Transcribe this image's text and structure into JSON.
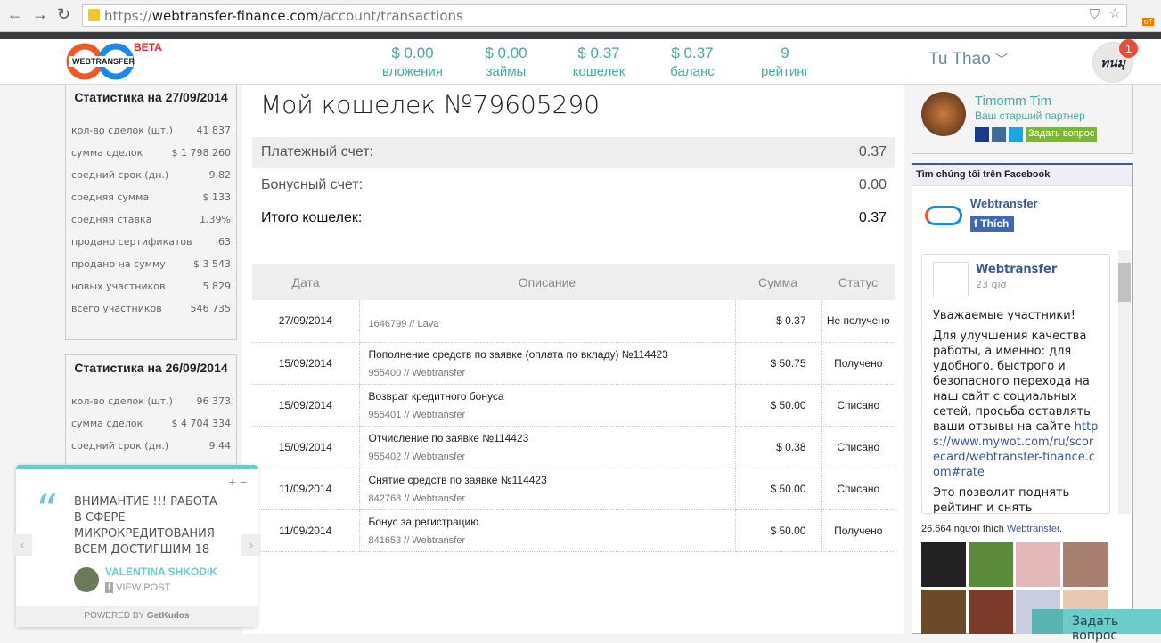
{
  "browser": {
    "url_scheme": "https://",
    "url_host": "webtransfer-finance.com",
    "url_path": "/account/transactions",
    "ext_badge": "off"
  },
  "header": {
    "beta": "BETA",
    "logo_text": "WEBTRANSFER",
    "stats": [
      {
        "value": "$ 0.00",
        "label": "вложения"
      },
      {
        "value": "$ 0.00",
        "label": "займы"
      },
      {
        "value": "$ 0.37",
        "label": "кошелек"
      },
      {
        "value": "$ 0.37",
        "label": "баланс"
      },
      {
        "value": "9",
        "label": "рейтинг"
      }
    ],
    "user": "Tu Thao",
    "notifications": "1",
    "avatar_text": "ทนมุ"
  },
  "stats": [
    {
      "title": "Статистика на 27/09/2014",
      "rows": [
        [
          "кол-во сделок (шт.)",
          "41 837"
        ],
        [
          "сумма сделок",
          "$ 1 798 260"
        ],
        [
          "средний срок (дн.)",
          "9.82"
        ],
        [
          "средняя сумма",
          "$ 133"
        ],
        [
          "средняя ставка",
          "1.39%"
        ],
        [
          "продано сертификатов",
          "63"
        ],
        [
          "продано на сумму",
          "$ 3 543"
        ],
        [
          "новых участников",
          "5 829"
        ],
        [
          "всего участников",
          "546 735"
        ]
      ]
    },
    {
      "title": "Статистика на 26/09/2014",
      "rows": [
        [
          "кол-во сделок (шт.)",
          "96 373"
        ],
        [
          "сумма сделок",
          "$ 4 704 334"
        ],
        [
          "средний срок (дн.)",
          "9.44"
        ]
      ]
    }
  ],
  "wallet": {
    "title": "Мой кошелек №79605290",
    "accounts": [
      {
        "label": "Платежный счет:",
        "value": "0.37"
      },
      {
        "label": "Бонусный счет:",
        "value": "0.00"
      },
      {
        "label": "Итого кошелек:",
        "value": "0.37"
      }
    ]
  },
  "table": {
    "headers": [
      "Дата",
      "Описание",
      "Сумма",
      "Статус"
    ],
    "rows": [
      {
        "date": "27/09/2014",
        "desc": "",
        "sub": "1646799 // Lava",
        "sum": "$ 0.37",
        "status": "Не получено"
      },
      {
        "date": "15/09/2014",
        "desc": "Пополнение средств по заявке (оплата по вкладу) №114423",
        "sub": "955400 // Webtransfer",
        "sum": "$ 50.75",
        "status": "Получено"
      },
      {
        "date": "15/09/2014",
        "desc": "Возврат кредитного бонуса",
        "sub": "955401 // Webtransfer",
        "sum": "$ 50.00",
        "status": "Списано"
      },
      {
        "date": "15/09/2014",
        "desc": "Отчисление по заявке №114423",
        "sub": "955402 // Webtransfer",
        "sum": "$ 0.38",
        "status": "Списано"
      },
      {
        "date": "11/09/2014",
        "desc": "Снятие средств по заявке №114423",
        "sub": "842768 // Webtransfer",
        "sum": "$ 50.00",
        "status": "Списано"
      },
      {
        "date": "11/09/2014",
        "desc": "Бонус за регистрацию",
        "sub": "841653 // Webtransfer",
        "sum": "$ 50.00",
        "status": "Получено"
      }
    ]
  },
  "partner": {
    "name": "Timomm Tim",
    "role": "Ваш старший партнер",
    "ask": "Задать вопрос"
  },
  "facebook": {
    "header": "Tìm chúng tôi trên Facebook",
    "page": "Webtransfer",
    "like": "Thích",
    "post_author": "Webtransfer",
    "post_time": "23 giờ",
    "post_p1": "Уважаемые участники!",
    "post_p2": "Для улучшения качества работы, а именно: для удобного. быстрого и безопасного перехода на наш сайт с социальных сетей, просьба оставлять ваши отзывы на сайте",
    "post_link": "https://www.mywot.com/ru/scorecard/webtransfer-finance.com#rate",
    "post_p3": "Это позволит поднять рейтинг и снять блокироку переходов",
    "likes_count": "26.664 người thích",
    "likes_page": "Webtransfer",
    "likes_dot": "."
  },
  "widget": {
    "quote": "ВНИМАНТИЕ !!! РАБОТА В СФЕРЕ МИКРОКРЕДИТОВАНИЯ ВСЕМ ДОСТИГШИМ 18",
    "author": "VALENTINA SHKODIK",
    "view": "VIEW POST",
    "powered": "POWERED BY",
    "brand": "GetKudos"
  },
  "chat": {
    "label": "Задать вопрос"
  }
}
